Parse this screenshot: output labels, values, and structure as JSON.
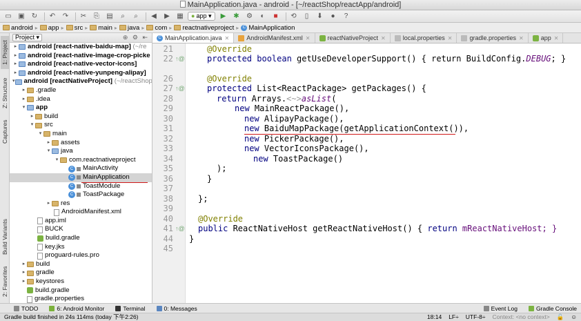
{
  "window": {
    "title": "MainApplication.java - android - [~/reactShop/reactApp/android]"
  },
  "toolbar": {
    "run_config": "app"
  },
  "breadcrumbs": [
    "android",
    "app",
    "src",
    "main",
    "java",
    "com",
    "reactnativeproject",
    "MainApplication"
  ],
  "left_strip": [
    "1: Project",
    "Z: Structure",
    "Captures",
    "Build Variants",
    "2: Favorites"
  ],
  "project_panel": {
    "selector": "Project",
    "rows": [
      {
        "text": "android [react-native-baidu-map]",
        "extra": "(~/re"
      },
      {
        "text": "android [react-native-image-crop-picke",
        "extra": ""
      },
      {
        "text": "android [react-native-vector-icons]",
        "extra": ""
      },
      {
        "text": "android [react-native-yunpeng-alipay]",
        "extra": ""
      },
      {
        "text": "android [reactNativeProject]",
        "extra": "(~/reactShop"
      },
      {
        "text": ".gradle",
        "extra": ""
      },
      {
        "text": ".idea",
        "extra": ""
      },
      {
        "text": "app",
        "extra": ""
      },
      {
        "text": "build",
        "extra": ""
      },
      {
        "text": "src",
        "extra": ""
      },
      {
        "text": "main",
        "extra": ""
      },
      {
        "text": "assets",
        "extra": ""
      },
      {
        "text": "java",
        "extra": ""
      },
      {
        "text": "com.reactnativeproject",
        "extra": ""
      },
      {
        "text": "MainActivity",
        "extra": ""
      },
      {
        "text": "MainApplication",
        "extra": ""
      },
      {
        "text": "ToastModule",
        "extra": ""
      },
      {
        "text": "ToastPackage",
        "extra": ""
      },
      {
        "text": "res",
        "extra": ""
      },
      {
        "text": "AndroidManifest.xml",
        "extra": ""
      },
      {
        "text": "app.iml",
        "extra": ""
      },
      {
        "text": "BUCK",
        "extra": ""
      },
      {
        "text": "build.gradle",
        "extra": ""
      },
      {
        "text": "key.jks",
        "extra": ""
      },
      {
        "text": "proguard-rules.pro",
        "extra": ""
      },
      {
        "text": "build",
        "extra": ""
      },
      {
        "text": "gradle",
        "extra": ""
      },
      {
        "text": "keystores",
        "extra": ""
      },
      {
        "text": "build.gradle",
        "extra": ""
      },
      {
        "text": "gradle.properties",
        "extra": ""
      }
    ]
  },
  "tabs": [
    "MainApplication.java",
    "AndroidManifest.xml",
    "reactNativeProject",
    "local.properties",
    "gradle.properties",
    "app"
  ],
  "editor": {
    "line_numbers": [
      "21",
      "22",
      "26",
      "27",
      "28",
      "29",
      "30",
      "31",
      "32",
      "33",
      "34",
      "35",
      "36",
      "37",
      "38",
      "39",
      "40",
      "41",
      "44",
      "45"
    ],
    "l21": "@Override",
    "l22a": "protected boolean ",
    "l22b": "getUseDeveloperSupport() { return BuildConfig.",
    "l22c": "DEBUG",
    "l22d": "; }",
    "l26": "@Override",
    "l27a": "protected ",
    "l27b": "List<ReactPackage> getPackages() {",
    "l28a": "return ",
    "l28b": "Arrays.",
    "l28c": "<~>",
    "l28d": "asList",
    "l28e": "(",
    "l29a": "new ",
    "l29b": "MainReactPackage(),",
    "l30a": "new ",
    "l30b": "AlipayPackage(),",
    "l31a": "new ",
    "l31b": "BaiduMapPackage(getApplicationContext()),",
    "l32a": "new ",
    "l32b": "PickerPackage(),",
    "l33a": "new ",
    "l33b": "VectorIconsPackage(),",
    "l34a": "new ",
    "l34b": "ToastPackage()",
    "l35": ");",
    "l36": "}",
    "l38": "};",
    "l40": "@Override",
    "l41a": "public ",
    "l41b": "ReactNativeHost getReactNativeHost() { ",
    "l41c": "return ",
    "l41d": "mReactNativeHost; }",
    "l44": "}"
  },
  "bottom_tabs": {
    "todo": "TODO",
    "monitor": "6: Android Monitor",
    "terminal": "Terminal",
    "messages": "0: Messages",
    "event_log": "Event Log",
    "gradle_console": "Gradle Console"
  },
  "status": {
    "message": "Gradle build finished in 24s 114ms (today 下午2:26)",
    "position": "18:14",
    "line_sep": "LF÷",
    "encoding": "UTF-8÷",
    "context": "Context: <no context>"
  },
  "colors": {
    "keyword": "#000080",
    "annotation": "#808000",
    "static_field": "#660e7a",
    "underline": "#d01818"
  }
}
